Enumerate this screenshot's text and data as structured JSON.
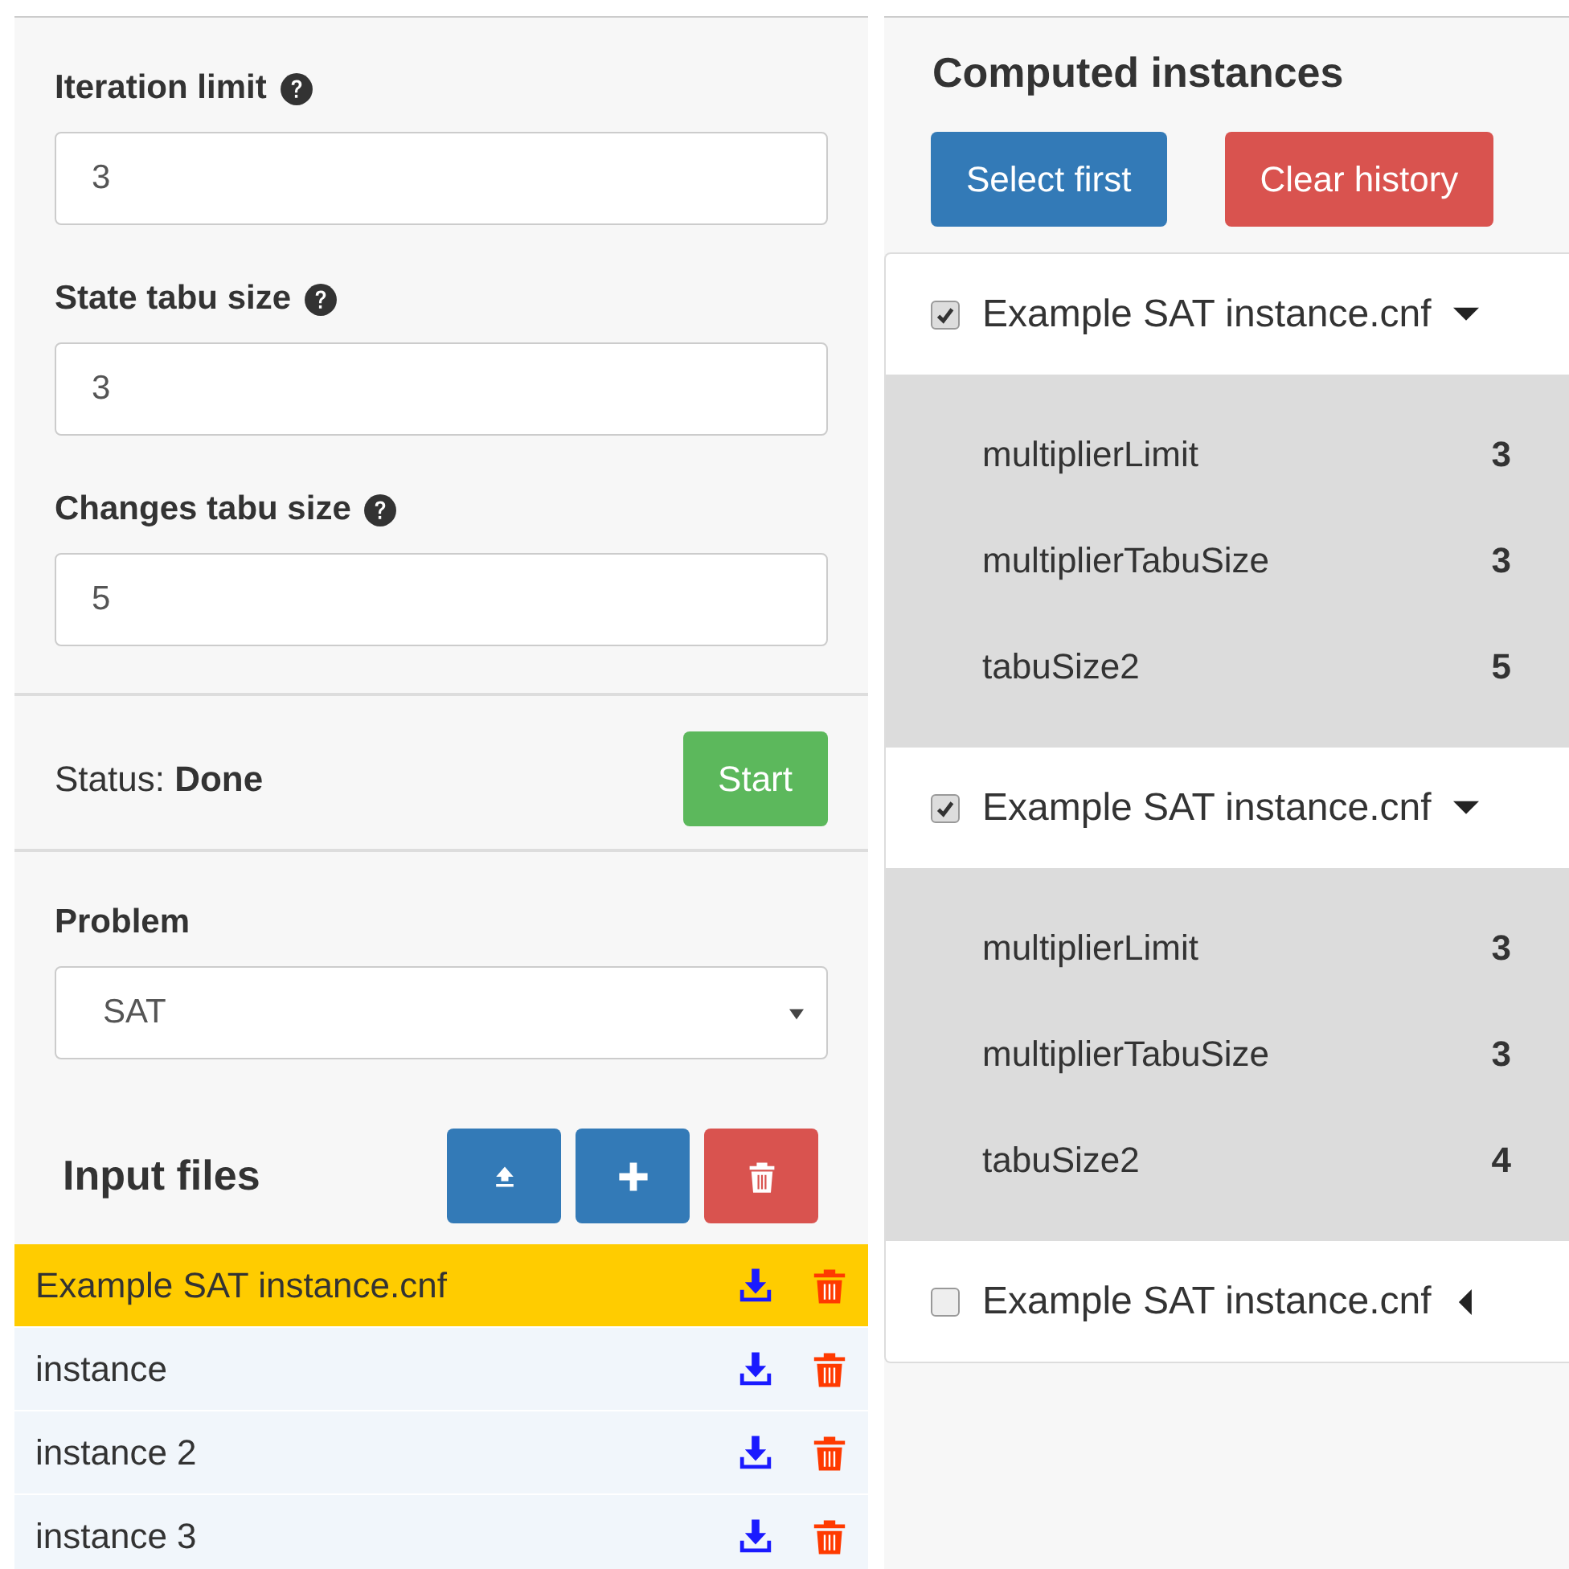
{
  "settings": {
    "fields": [
      {
        "label": "Iteration limit",
        "value": "3"
      },
      {
        "label": "State tabu size",
        "value": "3"
      },
      {
        "label": "Changes tabu size",
        "value": "5"
      }
    ],
    "status": "Status: **Done**",
    "start_button": "Start",
    "problem": {
      "label": "Problem",
      "value": "SAT"
    },
    "input_files": {
      "title": "Input files",
      "files": [
        {
          "name": "Example SAT instance.cnf",
          "selected": true
        },
        {
          "name": "instance",
          "selected": false
        },
        {
          "name": "instance 2",
          "selected": false
        },
        {
          "name": "instance 3",
          "selected": false
        }
      ]
    }
  },
  "computed": {
    "title": "Computed instances",
    "buttons": [
      {
        "label": "Select first",
        "kind": "primary"
      },
      {
        "label": "Clear history",
        "kind": "danger"
      }
    ],
    "instances": [
      {
        "name": "Example SAT instance.cnf",
        "checked": true,
        "expanded": true,
        "params": [
          {
            "name": "multiplierLimit",
            "value": "3"
          },
          {
            "name": "multiplierTabuSize",
            "value": "3"
          },
          {
            "name": "tabuSize2",
            "value": "5"
          }
        ]
      },
      {
        "name": "Example SAT instance.cnf",
        "checked": true,
        "expanded": true,
        "params": [
          {
            "name": "multiplierLimit",
            "value": "3"
          },
          {
            "name": "multiplierTabuSize",
            "value": "3"
          },
          {
            "name": "tabuSize2",
            "value": "4"
          }
        ]
      },
      {
        "name": "Example SAT instance.cnf",
        "checked": false,
        "expanded": false
      }
    ]
  }
}
